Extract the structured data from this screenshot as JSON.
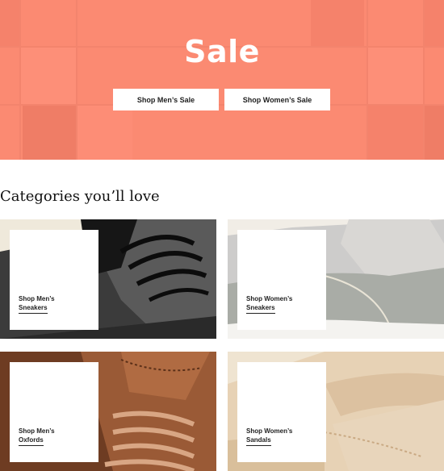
{
  "hero": {
    "title": "Sale",
    "buttons": {
      "mens": "Shop Men’s Sale",
      "womens": "Shop Women’s Sale"
    },
    "background_color": "#fb8a72"
  },
  "section": {
    "heading": "Categories you’ll love"
  },
  "categories": [
    {
      "line1": "Shop Men’s",
      "line2": "Sneakers"
    },
    {
      "line1": "Shop Women’s",
      "line2": "Sneakers"
    },
    {
      "line1": "Shop Men’s",
      "line2": "Oxfords"
    },
    {
      "line1": "Shop Women’s",
      "line2": "Sandals"
    }
  ]
}
